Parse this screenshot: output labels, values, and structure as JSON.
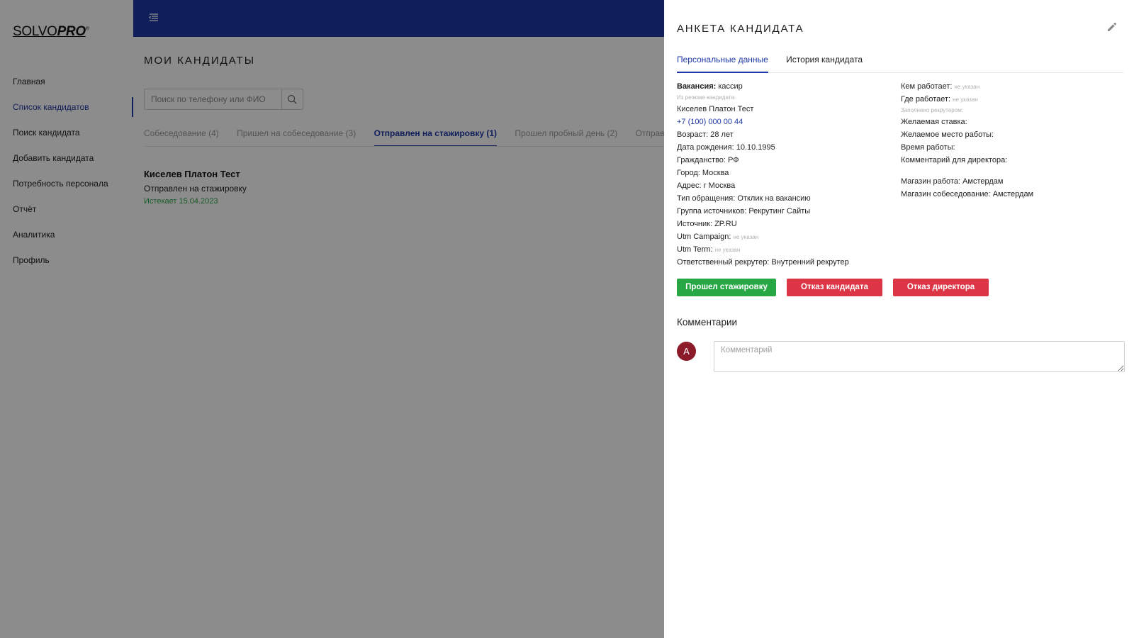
{
  "sidebar": {
    "logo": {
      "part1": "SOLVO",
      "part2": "PRO",
      "mark": "®"
    },
    "items": [
      {
        "label": "Главная"
      },
      {
        "label": "Список кандидатов",
        "active": true
      },
      {
        "label": "Поиск кандидата"
      },
      {
        "label": "Добавить кандидата"
      },
      {
        "label": "Потребность персонала"
      },
      {
        "label": "Отчёт"
      },
      {
        "label": "Аналитика"
      },
      {
        "label": "Профиль"
      }
    ]
  },
  "topbar": {
    "menu_icon": "menu-icon",
    "color": "#1e3aa8"
  },
  "main": {
    "title": "МОИ КАНДИДАТЫ",
    "search": {
      "placeholder": "Поиск по телефону или ФИО",
      "icon": "search-icon"
    },
    "tabs": [
      {
        "label": "Собеседование (4)"
      },
      {
        "label": "Пришел на собеседование (3)"
      },
      {
        "label": "Отправлен на стажировку (1)",
        "active": true
      },
      {
        "label": "Прошел пробный день (2)"
      },
      {
        "label": "Отправл"
      }
    ],
    "candidate": {
      "name": "Киселев Платон Тест",
      "status": "Отправлен на стажировку",
      "expires": "Истекает 15.04.2023"
    }
  },
  "drawer": {
    "title": "АНКЕТА КАНДИДАТА",
    "edit_icon": "pencil-icon",
    "tabs": [
      {
        "label": "Персональные данные",
        "active": true
      },
      {
        "label": "История кандидата"
      }
    ],
    "left": {
      "vacancy_label": "Вакансия:",
      "vacancy_value": "кассир",
      "resume_hint": "Из резюме кандидата:",
      "name": "Киселев Платон Тест",
      "phone": "+7 (100) 000 00 44",
      "age": "Возраст: 28 лет",
      "birth": "Дата рождения: 10.10.1995",
      "citizenship": "Гражданство: РФ",
      "city": "Город: Москва",
      "address": "Адрес: г Москва",
      "request_type": "Тип обращения: Отклик на вакансию",
      "source_group": "Группа источников: Рекрутинг Сайты",
      "source": "Источник: ZP.RU",
      "utm_campaign_label": "Utm Campaign:",
      "utm_campaign_value": "не указан",
      "utm_term_label": "Utm Term:",
      "utm_term_value": "не указан",
      "recruiter": "Ответственный рекрутер: Внутренний рекрутер"
    },
    "right": {
      "works_as_label": "Кем работает:",
      "works_as_value": "не указан",
      "works_where_label": "Где работает:",
      "works_where_value": "не указан",
      "recruiter_hint": "Заполнено рекрутером:",
      "desired_rate": "Желаемая ставка:",
      "desired_place": "Желаемое место работы:",
      "work_time": "Время работы:",
      "director_comment": "Комментарий для директора:",
      "store_work": "Магазин работа: Амстердам",
      "store_interview": "Магазин собеседование: Амстердам"
    },
    "actions": {
      "passed": "Прошел стажировку",
      "candidate_reject": "Отказ кандидата",
      "director_reject": "Отказ директора"
    },
    "comments": {
      "title": "Комментарии",
      "avatar_letter": "А",
      "placeholder": "Комментарий"
    }
  }
}
